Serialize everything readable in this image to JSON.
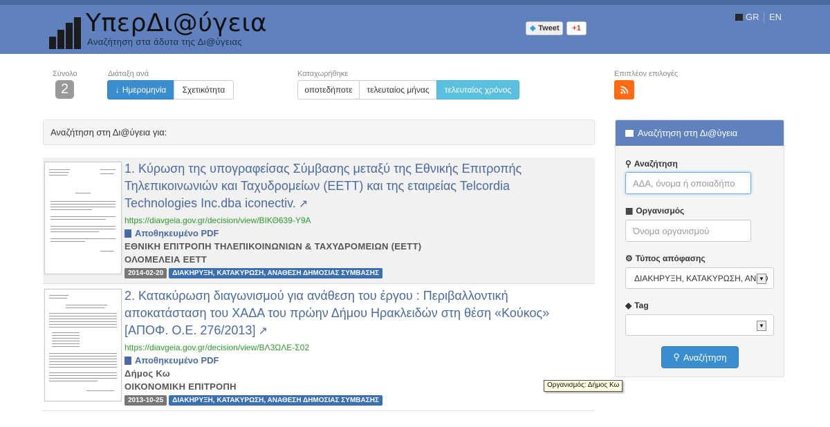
{
  "header": {
    "title": "ΥπερΔι@ύγεια",
    "subtitle": "Αναζήτηση στα άδυτα της Δι@ύγειας",
    "tweet_label": "Tweet",
    "gplus_label": "+1",
    "lang_gr": "GR",
    "lang_en": "EN",
    "brand_color": "#5f82bf"
  },
  "toolbar": {
    "total_label": "Σύνολο",
    "total_count": "2",
    "sort_label": "Διάταξη ανά",
    "sort_options": [
      "Ημερομηνία",
      "Σχετικότητα"
    ],
    "sort_selected": "Ημερομηνία",
    "registered_label": "Καταχωρήθηκε",
    "registered_options": [
      "οποτεδήποτε",
      "τελευταίος μήνας",
      "τελευταίος χρόνος"
    ],
    "registered_selected": "τελευταίος χρόνος",
    "more_label": "Επιπλέον επιλογές",
    "rss_icon": "rss-icon"
  },
  "search_for": "Αναζήτηση στη Δι@ύγεια για:",
  "results": [
    {
      "title": "1. Κύρωση της υπογραφείσας Σύμβασης μεταξύ της Εθνικής Επιτροπής Τηλεπικοινωνιών και Ταχυδρομείων (ΕΕΤΤ) και της εταιρείας Telcordia Technologies Inc.dba iconectiv.",
      "url": "https://diavgeia.gov.gr/decision/view/ΒΙΚΘ639-Υ9Α",
      "pdf": "Αποθηκευμένο PDF",
      "org": "ΕΘΝΙΚΗ ΕΠΙΤΡΟΠΗ ΤΗΛΕΠΙΚΟΙΝΩΝΙΩΝ & ΤΑΧΥΔΡΟΜΕΙΩΝ (ΕΕΤΤ)",
      "unit": "ΟΛΟΜΕΛΕΙΑ ΕΕΤΤ",
      "date": "2014-02-20",
      "type": "ΔΙΑΚΗΡΥΞΗ, ΚΑΤΑΚΥΡΩΣΗ, ΑΝΑΘΕΣΗ ΔΗΜΟΣΙΑΣ ΣΥΜΒΑΣΗΣ"
    },
    {
      "title": "2. Κατακύρωση διαγωνισμού για ανάθεση του έργου : Περιβαλλοντική αποκατάσταση του ΧΑΔΑ του πρώην Δήμου Ηρακλειδών στη θέση «Κούκος» [ΑΠΟΦ. Ο.Ε. 276/2013]",
      "url": "https://diavgeia.gov.gr/decision/view/ΒΛ3ΩΛΕ-Σ02",
      "pdf": "Αποθηκευμένο PDF",
      "org": "Δήμος Κω",
      "unit": "ΟΙΚΟΝΟΜΙΚΗ ΕΠΙΤΡΟΠΗ",
      "date": "2013-10-25",
      "type": "ΔΙΑΚΗΡΥΞΗ, ΚΑΤΑΚΥΡΩΣΗ, ΑΝΑΘΕΣΗ ΔΗΜΟΣΙΑΣ ΣΥΜΒΑΣΗΣ"
    }
  ],
  "sidebar": {
    "heading": "Αναζήτηση στη Δι@ύγεια",
    "search_label": "Αναζήτηση",
    "search_placeholder": "ΑΔΑ, όνομα ή οποιαδήπο",
    "org_label": "Οργανισμός",
    "org_placeholder": "Όνομα οργανισμού",
    "type_label": "Τύπος απόφασης",
    "type_value": "ΔΙΑΚΗΡΥΞΗ, ΚΑΤΑΚΥΡΩΣΗ, ΑΝΑΘ",
    "tag_label": "Tag",
    "tag_value": "",
    "button_label": "Αναζήτηση"
  },
  "tooltip": "Οργανισμός: Δήμος Κω"
}
